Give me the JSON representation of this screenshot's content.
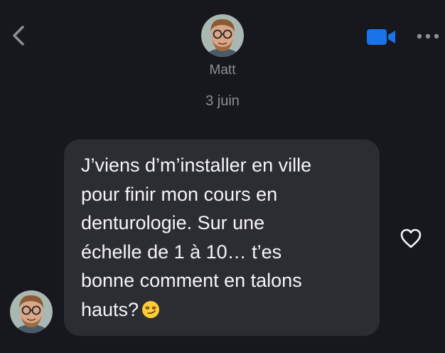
{
  "header": {
    "contact_name": "Matt",
    "back_icon": "chevron-left-icon",
    "video_icon": "video-camera-icon",
    "more_icon": "more-horizontal-icon",
    "accent_color": "#1a73e8"
  },
  "thread": {
    "date_label": "3 juin",
    "messages": [
      {
        "sender": "Matt",
        "text": "J’viens d’m’installer en ville\npour finir mon cours en\ndenturologie. Sur une\néchelle de 1 à 10… t’es\nbonne comment en talons\nhauts?",
        "emoji": "smirking-face",
        "bubble_color": "#2c2d33",
        "reaction_icon": "heart-outline-icon"
      }
    ]
  }
}
